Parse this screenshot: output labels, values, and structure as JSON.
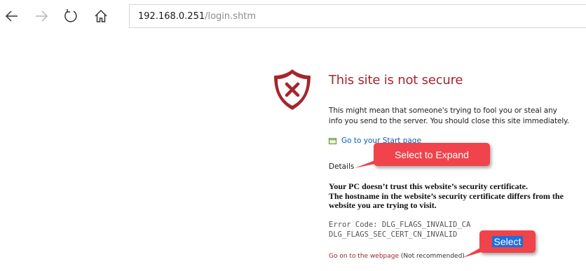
{
  "browser": {
    "url_host": "192.168.0.251",
    "url_path": "/login.shtm",
    "icons": [
      "back-icon",
      "forward-icon",
      "refresh-icon",
      "home-icon"
    ]
  },
  "warning": {
    "icon": "shield-error-icon",
    "title": "This site is not secure",
    "description": "This might mean that someone's trying to fool you or steal any info you send to the server. You should close this site immediately.",
    "start_link": "Go to your Start page",
    "details_label": "Details",
    "details_text": [
      "Your PC doesn’t trust this website’s security certificate.",
      "The hostname in the website’s security certificate differs from the",
      "website you are trying to visit."
    ],
    "error_codes": [
      "Error Code: DLG_FLAGS_INVALID_CA",
      "DLG_FLAGS_SEC_CERT_CN_INVALID"
    ],
    "go_on_link": "Go on to the webpage",
    "go_on_note": "(Not recommended)"
  },
  "annotations": {
    "expand_callout": "Select to Expand",
    "select_callout": "Select",
    "color": "#f0434b"
  },
  "colors": {
    "accent_red": "#a4262c",
    "link_blue": "#0a5eb3"
  }
}
